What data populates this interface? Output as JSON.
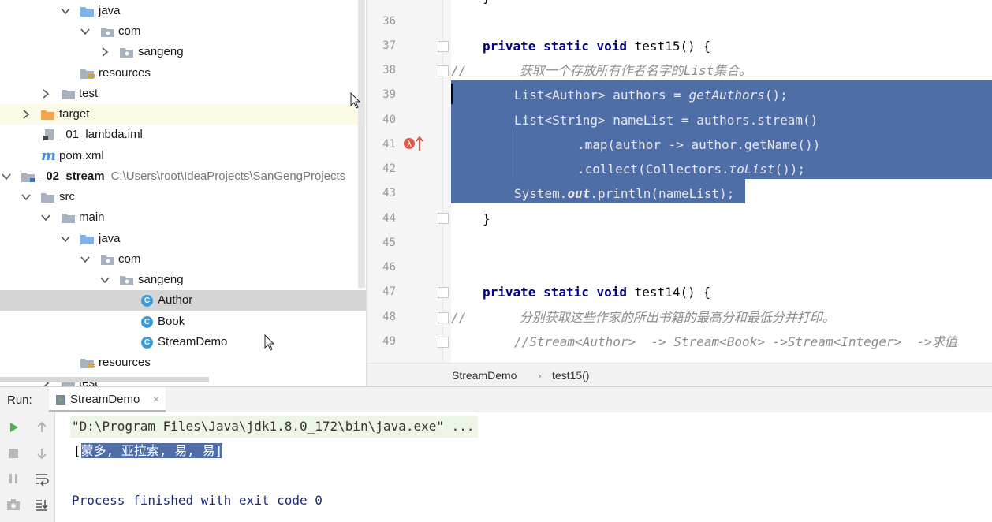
{
  "tree": {
    "rows": [
      {
        "label": "java"
      },
      {
        "label": "com"
      },
      {
        "label": "sangeng"
      },
      {
        "label": "resources"
      },
      {
        "label": "test"
      },
      {
        "label": "target"
      },
      {
        "label": "_01_lambda.iml"
      },
      {
        "label": "pom.xml"
      },
      {
        "label": "_02_stream",
        "path": "C:\\Users\\root\\IdeaProjects\\SanGengProjects"
      },
      {
        "label": "src"
      },
      {
        "label": "main"
      },
      {
        "label": "java"
      },
      {
        "label": "com"
      },
      {
        "label": "sangeng"
      },
      {
        "label": "Author"
      },
      {
        "label": "Book"
      },
      {
        "label": "StreamDemo"
      },
      {
        "label": "resources"
      },
      {
        "label": "test"
      }
    ]
  },
  "editor": {
    "line_numbers": [
      "36",
      "37",
      "38",
      "39",
      "40",
      "41",
      "42",
      "43",
      "44",
      "45",
      "46",
      "47",
      "48",
      "49"
    ],
    "lines": {
      "l37_kw": "private static void",
      "l37_rest": " test15() {",
      "l38": "//       获取一个存放所有作者名字的List集合。",
      "l39_a": "List<Author> authors = ",
      "l39_b": "getAuthors",
      "l39_c": "();",
      "l40": "List<String> nameList = authors.stream()",
      "l41": ".map(author -> author.getName())",
      "l42_a": ".collect(Collectors.",
      "l42_b": "toList",
      "l42_c": "());",
      "l43_a": "System.",
      "l43_b": "out",
      "l43_c": ".println(nameList);",
      "l44": "}",
      "l47_kw": "private static void",
      "l47_rest": " test14() {",
      "l48": "//       分别获取这些作家的所出书籍的最高分和最低分并打印。",
      "l49": "//Stream<Author>  -> Stream<Book> ->Stream<Integer>  ->求值"
    },
    "breadcrumb": {
      "class": "StreamDemo",
      "separator": "›",
      "method": "test15()"
    }
  },
  "run": {
    "title": "Run:",
    "tab": "StreamDemo",
    "tab_close": "×",
    "console": {
      "line1": "\"D:\\Program Files\\Java\\jdk1.8.0_172\\bin\\java.exe\" ...",
      "line2_open": "[",
      "line2_sel": "蒙多, 亚拉索, 易, 易]",
      "line3": "Process finished with exit code 0"
    }
  },
  "colors": {
    "selection": "#4f6ea8",
    "keyword": "#000080",
    "comment": "#8c8c8c",
    "folder": "#7db3e8",
    "target_folder": "#f5a64b"
  }
}
